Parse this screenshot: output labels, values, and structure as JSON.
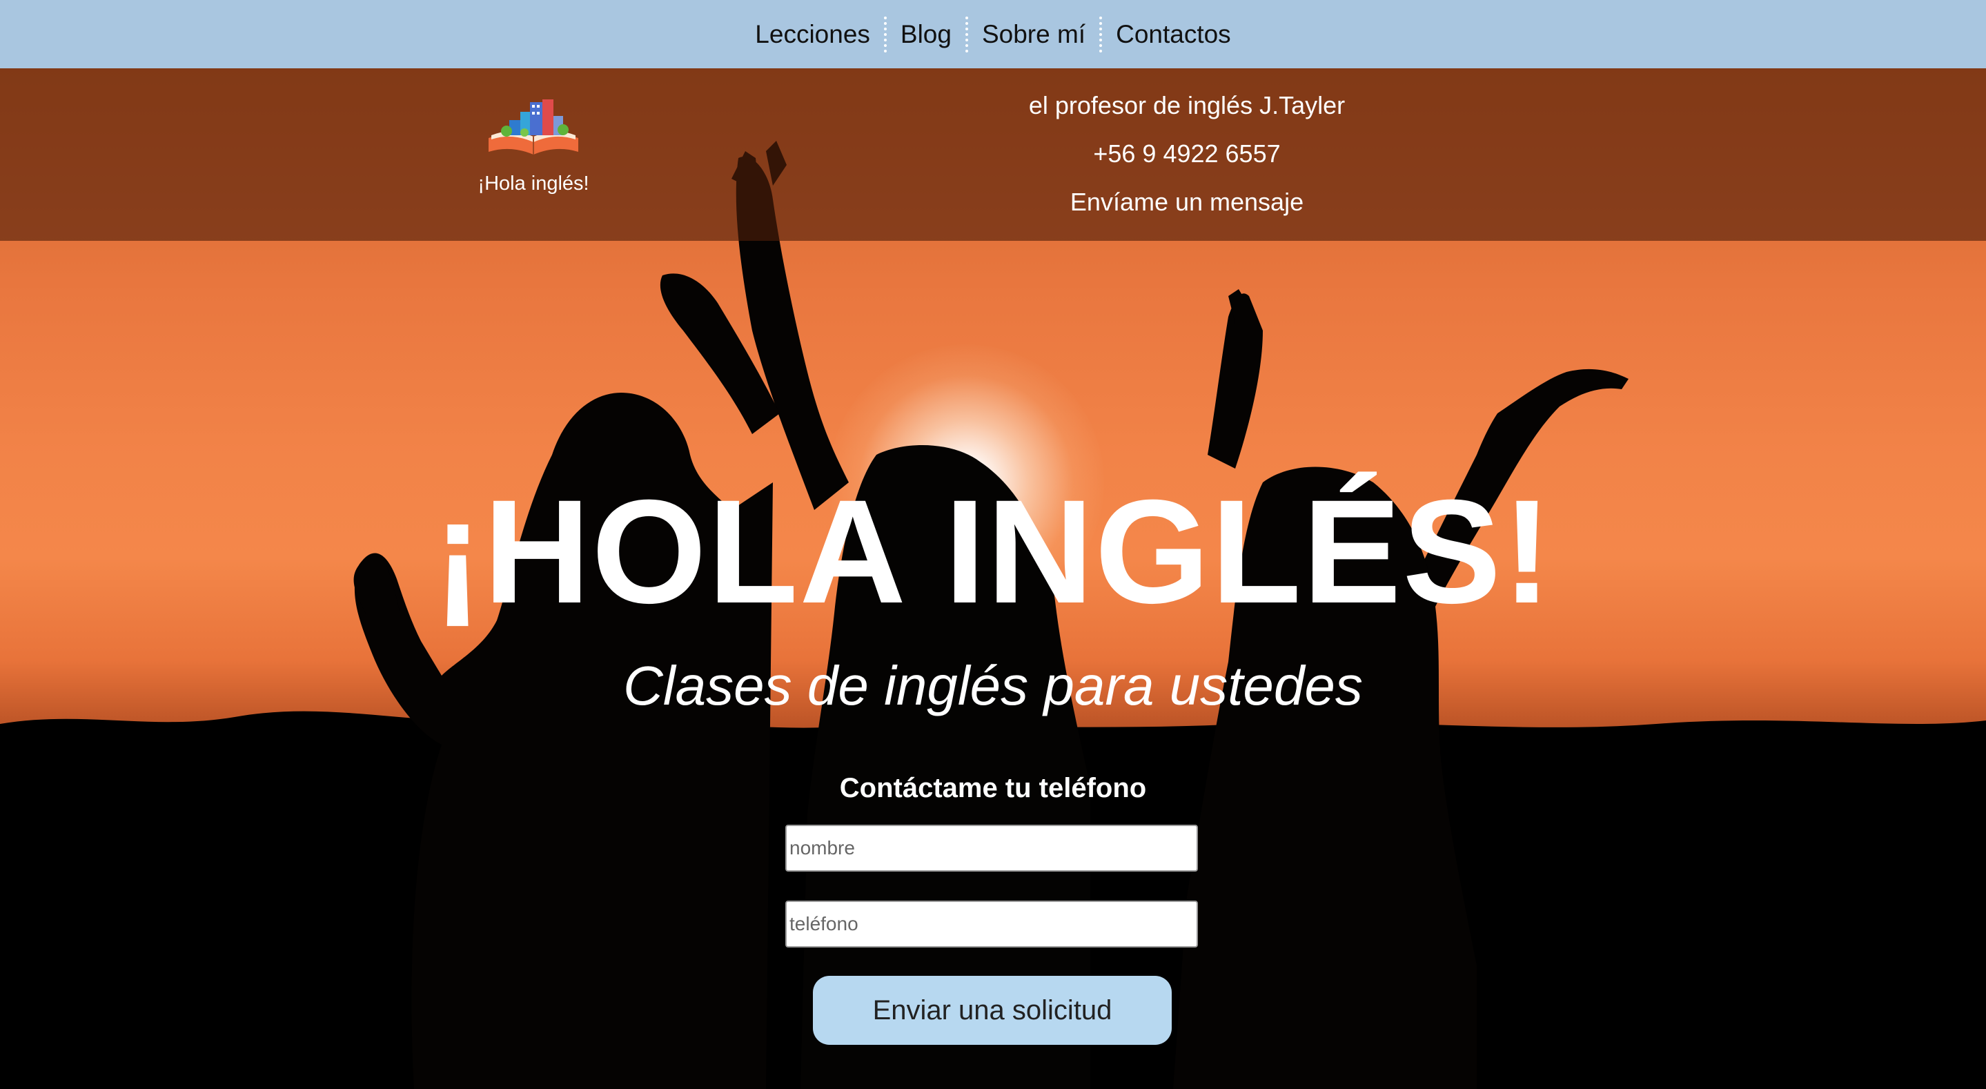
{
  "nav": {
    "items": [
      {
        "label": "Lecciones"
      },
      {
        "label": "Blog"
      },
      {
        "label": "Sobre mí"
      },
      {
        "label": "Contactos"
      }
    ]
  },
  "header": {
    "logo_icon": "open-book-city-logo",
    "logo_caption": "¡Hola inglés!",
    "teacher": "el profesor de inglés J.Tayler",
    "phone": "+56 9 4922 6557",
    "message_link": "Envíame un mensaje"
  },
  "hero": {
    "title": "¡HOLA INGLÉS!",
    "subtitle": "Clases de inglés para ustedes"
  },
  "form": {
    "title": "Contáctame tu teléfono",
    "name_placeholder": "nombre",
    "phone_placeholder": "teléfono",
    "submit_label": "Enviar una solicitud"
  },
  "colors": {
    "nav_background": "#a9c6e0",
    "button_background": "#b7d8f0",
    "sunset_orange": "#f28348"
  }
}
